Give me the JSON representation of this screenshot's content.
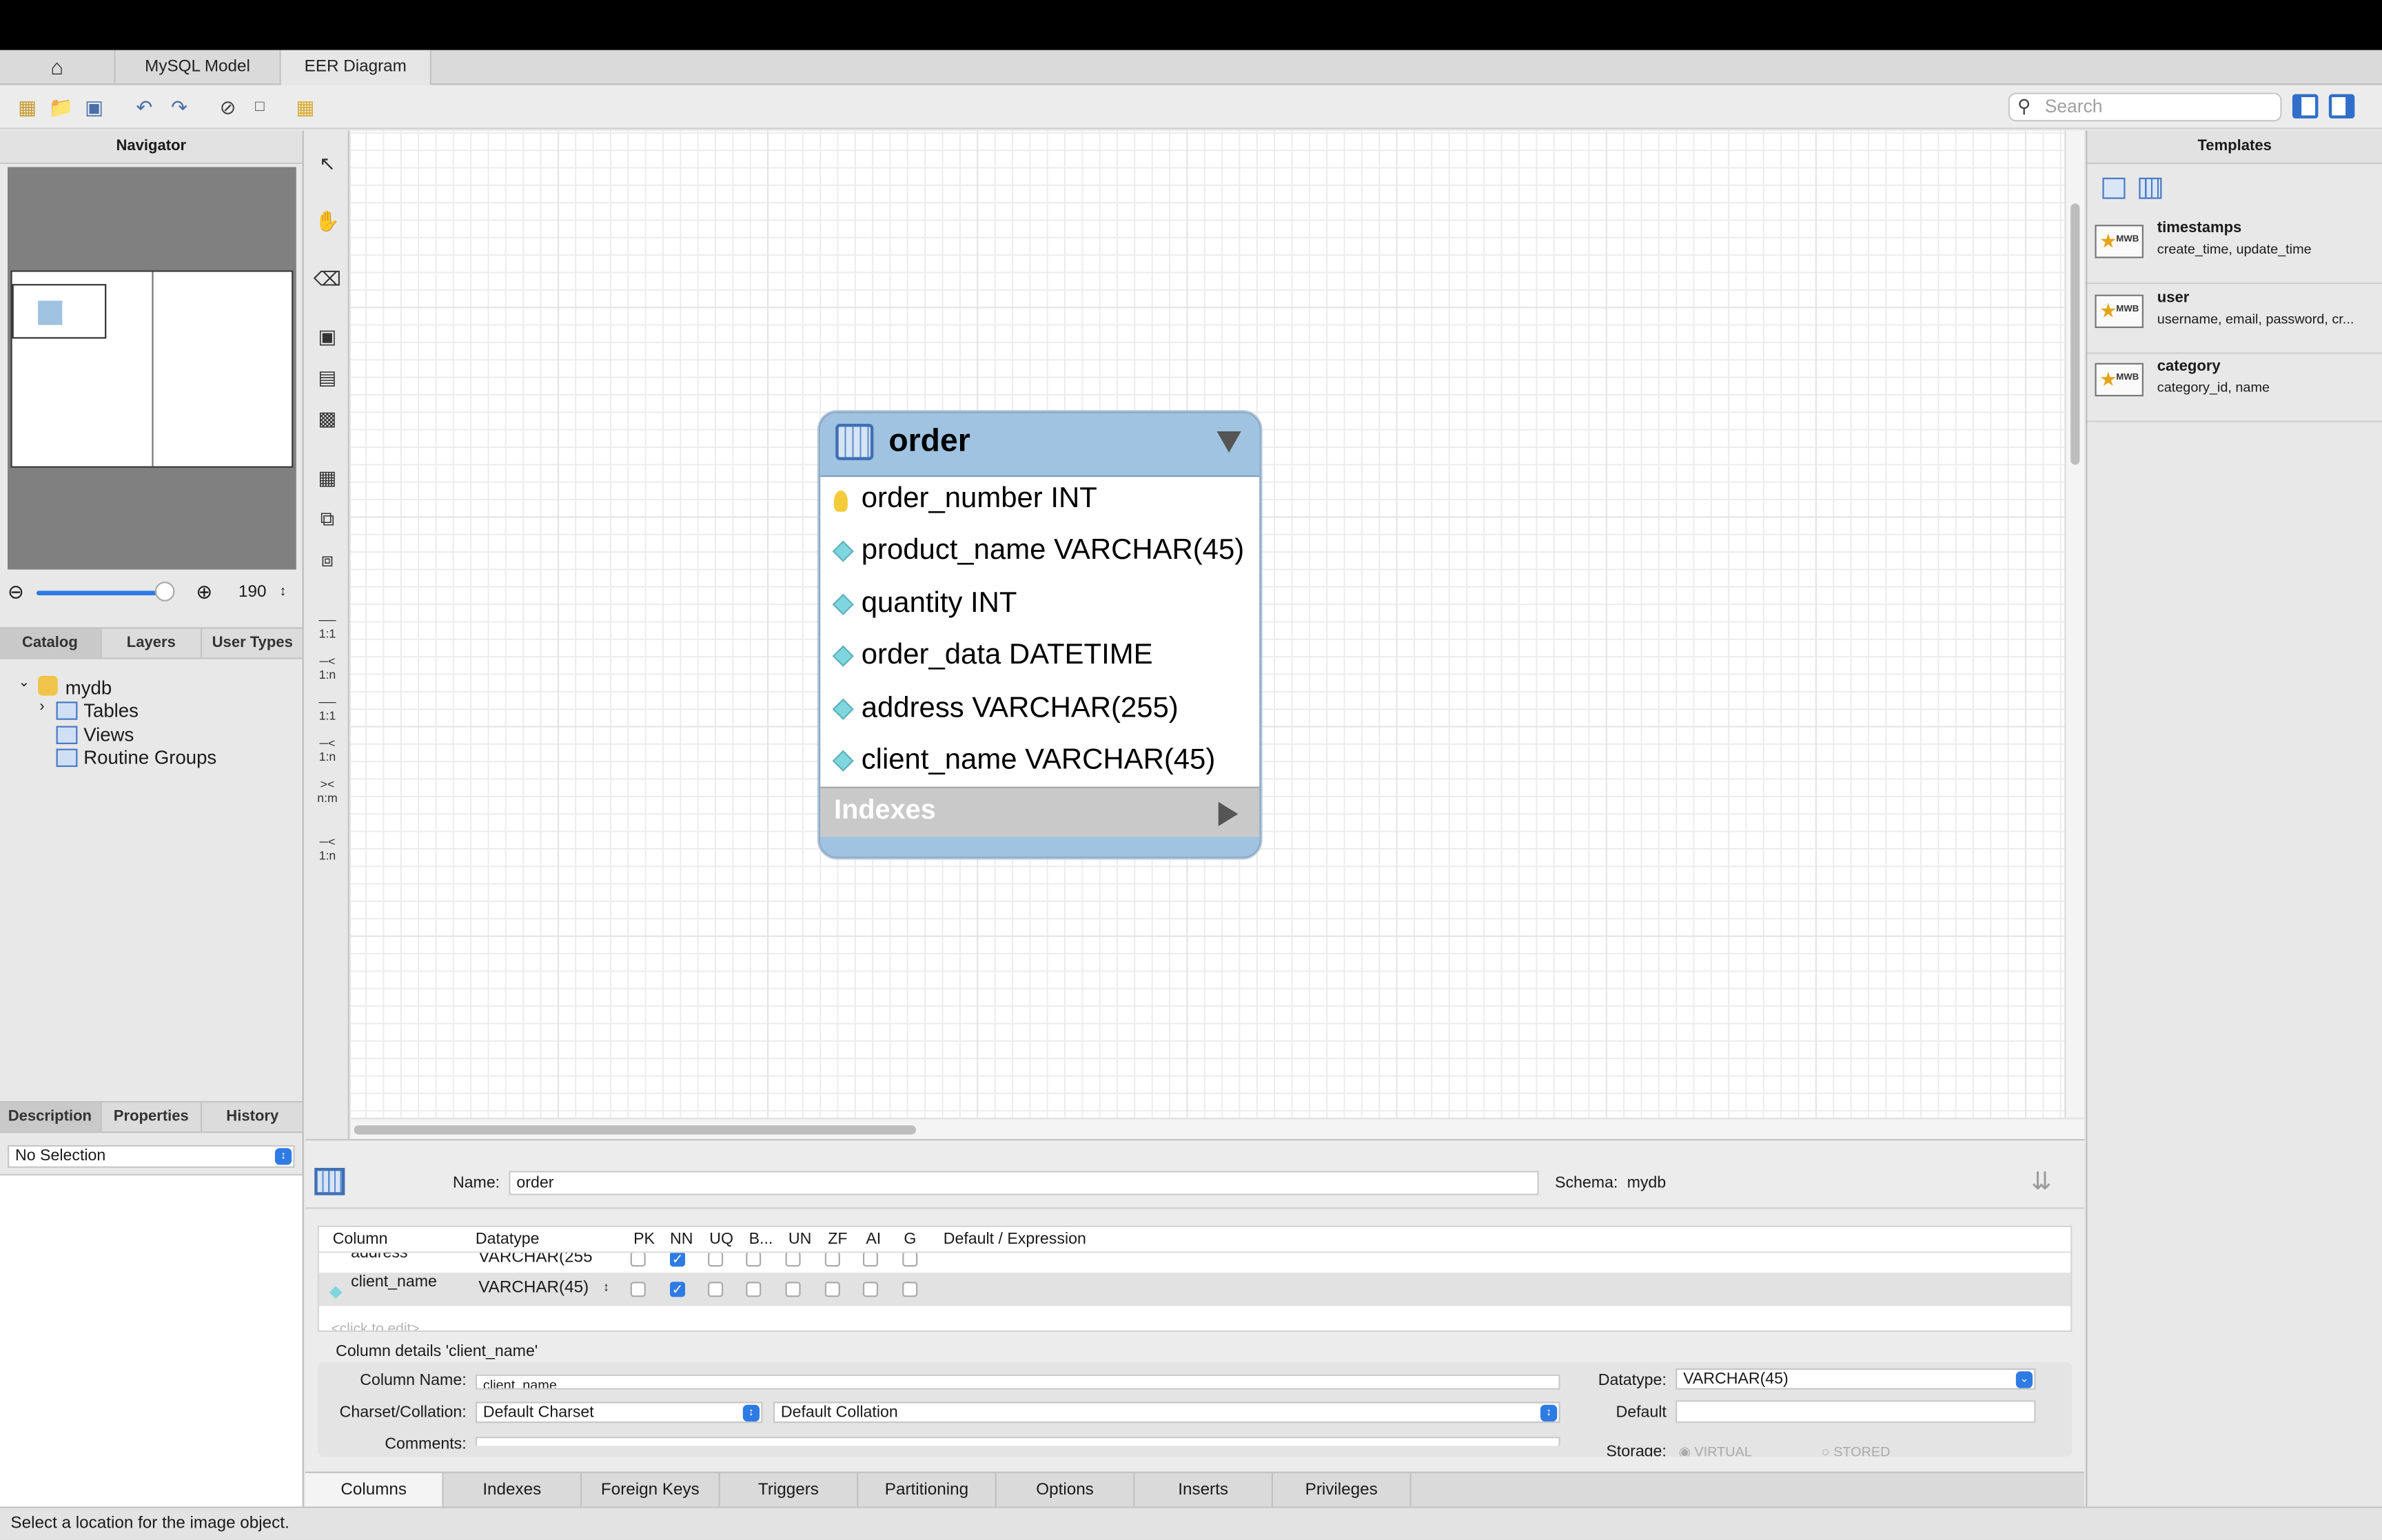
{
  "tabs": {
    "home_icon": "home-icon",
    "model": "MySQL Model",
    "eer": "EER Diagram"
  },
  "toolbar": {
    "search_placeholder": "Search"
  },
  "navigator": {
    "title": "Navigator",
    "zoom": "190"
  },
  "catalog_tabs": [
    "Catalog",
    "Layers",
    "User Types"
  ],
  "tree": {
    "schema": "mydb",
    "tables": "Tables",
    "views": "Views",
    "routines": "Routine Groups"
  },
  "desc_tabs": [
    "Description",
    "Properties",
    "History"
  ],
  "selection": "No Selection",
  "tools": {
    "one_one": "1:1",
    "one_n": "1:n",
    "one_one_b": "1:1",
    "one_n_b": "1:n",
    "n_m": "n:m",
    "one_n_c": "1:n"
  },
  "entity": {
    "name": "order",
    "columns": [
      {
        "text": "order_number INT",
        "kind": "pk"
      },
      {
        "text": "product_name VARCHAR(45)",
        "kind": "col"
      },
      {
        "text": "quantity INT",
        "kind": "col"
      },
      {
        "text": "order_data DATETIME",
        "kind": "col"
      },
      {
        "text": "address VARCHAR(255)",
        "kind": "col"
      },
      {
        "text": "client_name VARCHAR(45)",
        "kind": "col"
      }
    ],
    "indexes_label": "Indexes"
  },
  "templates": {
    "title": "Templates",
    "items": [
      {
        "name": "timestamps",
        "fields": "create_time, update_time"
      },
      {
        "name": "user",
        "fields": "username, email, password, cr..."
      },
      {
        "name": "category",
        "fields": "category_id, name"
      }
    ]
  },
  "editor": {
    "name_label": "Name:",
    "name_value": "order",
    "schema_label": "Schema:",
    "schema_value": "mydb",
    "headers": [
      "Column",
      "Datatype",
      "PK",
      "NN",
      "UQ",
      "B...",
      "UN",
      "ZF",
      "AI",
      "G",
      "Default / Expression"
    ],
    "rows": [
      {
        "name": "address",
        "type": "VARCHAR(255",
        "nn": true
      },
      {
        "name": "client_name",
        "type": "VARCHAR(45)",
        "nn": true
      }
    ],
    "click_to_edit": "<click to edit>",
    "details_title": "Column details 'client_name'",
    "column_name_label": "Column Name:",
    "column_name_value": "client_name",
    "datatype_label": "Datatype:",
    "datatype_value": "VARCHAR(45)",
    "charset_label": "Charset/Collation:",
    "charset_value": "Default Charset",
    "collation_value": "Default Collation",
    "default_label": "Default",
    "comments_label": "Comments:",
    "storage_label": "Storage:",
    "virtual": "VIRTUAL",
    "stored": "STORED"
  },
  "bottom_tabs": [
    "Columns",
    "Indexes",
    "Foreign Keys",
    "Triggers",
    "Partitioning",
    "Options",
    "Inserts",
    "Privileges"
  ],
  "status": "Select a location for the image object."
}
